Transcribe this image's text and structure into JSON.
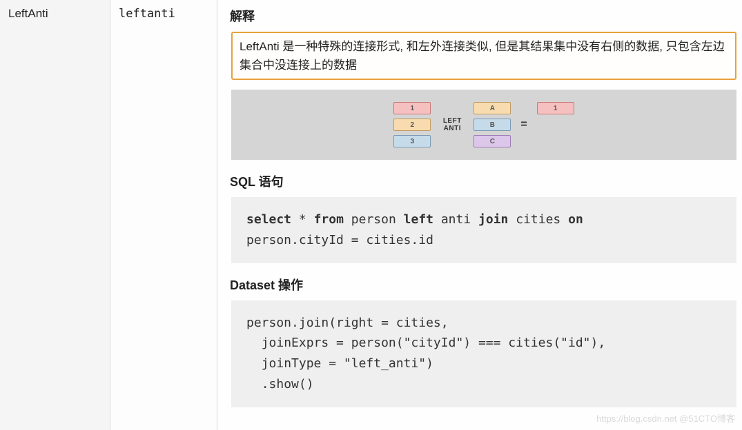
{
  "columns": {
    "name": "LeftAnti",
    "alias": "leftanti"
  },
  "content": {
    "heading_explain": "解释",
    "explain_text": "LeftAnti 是一种特殊的连接形式, 和左外连接类似, 但是其结果集中没有右侧的数据, 只包含左边集合中没连接上的数据",
    "heading_sql": "SQL 语句",
    "heading_dataset": "Dataset 操作"
  },
  "diagram": {
    "left": [
      "1",
      "2",
      "3"
    ],
    "op": "LEFT ANTI",
    "right": [
      "A",
      "B",
      "C"
    ],
    "eq": "=",
    "result": [
      "1"
    ]
  },
  "sql": {
    "tokens": {
      "select": "select",
      "star": "*",
      "from": "from",
      "person": "person",
      "left": "left",
      "anti": "anti",
      "join": "join",
      "cities": "cities",
      "on": "on",
      "line2": "person.cityId = cities.id"
    }
  },
  "dataset": {
    "l1": "person.join(right = cities,",
    "l2": "  joinExprs = person(\"cityId\") === cities(\"id\"),",
    "l3": "  joinType = \"left_anti\")",
    "l4": "  .show()"
  },
  "watermark": "https://blog.csdn.net @51CTO博客"
}
